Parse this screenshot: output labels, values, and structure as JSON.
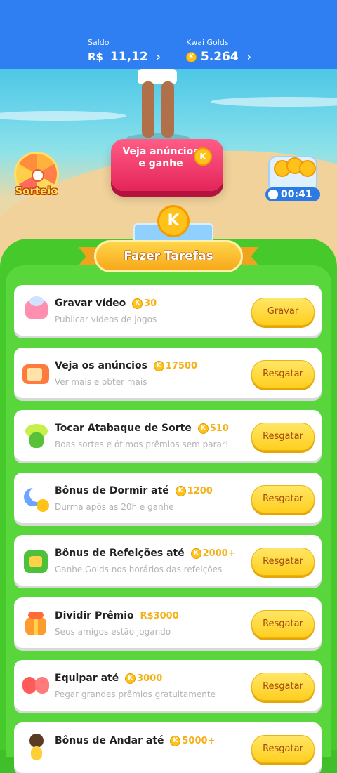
{
  "header": {
    "saldo_label": "Saldo",
    "saldo_currency": "R$",
    "saldo_value": "11,12",
    "golds_label": "Kwai Golds",
    "golds_value": "5.264",
    "chevron": "›"
  },
  "scene": {
    "ads_button": "Veja anúncios e ganhe",
    "wheel_label": "Sorteio",
    "timer": "00:41",
    "coin_symbol": "K"
  },
  "section_title": "Fazer Tarefas",
  "tasks": [
    {
      "title": "Gravar vídeo",
      "reward": "30",
      "subtitle": "Publicar vídeos de jogos",
      "button": "Gravar",
      "icon": "camera-icon"
    },
    {
      "title": "Veja os anúncios",
      "reward": "17500",
      "subtitle": "Ver mais e obter mais",
      "button": "Resgatar",
      "icon": "tv-icon"
    },
    {
      "title": "Tocar Atabaque de Sorte",
      "reward": "510",
      "subtitle": "Boas sortes e ótimos prêmios sem parar!",
      "button": "Resgatar",
      "icon": "drum-icon"
    },
    {
      "title": "Bônus de Dormir até",
      "reward": "1200",
      "subtitle": "Durma após as 20h e ganhe",
      "button": "Resgatar",
      "icon": "moon-icon"
    },
    {
      "title": "Bônus de Refeições até",
      "reward": "2000+",
      "subtitle": "Ganhe Golds nos horários das refeições",
      "button": "Resgatar",
      "icon": "calendar-icon"
    },
    {
      "title": "Dividir Prêmio",
      "reward": "R$3000",
      "subtitle": "Seus amigos estão jogando",
      "button": "Resgatar",
      "icon": "gift-icon"
    },
    {
      "title": "Equipar até",
      "reward": "3000",
      "subtitle": "Pegar grandes prêmios gratuitamente",
      "button": "Resgatar",
      "icon": "boxing-gloves-icon"
    },
    {
      "title": "Bônus de Andar até",
      "reward": "5000+",
      "subtitle": "",
      "button": "Resgatar",
      "icon": "walking-person-icon"
    }
  ],
  "colors": {
    "header_blue": "#2f7ff2",
    "panel_green": "#45c92b",
    "button_yellow": "#ffd23a",
    "reward_gold": "#f3b219",
    "ads_pink": "#e4245a"
  }
}
